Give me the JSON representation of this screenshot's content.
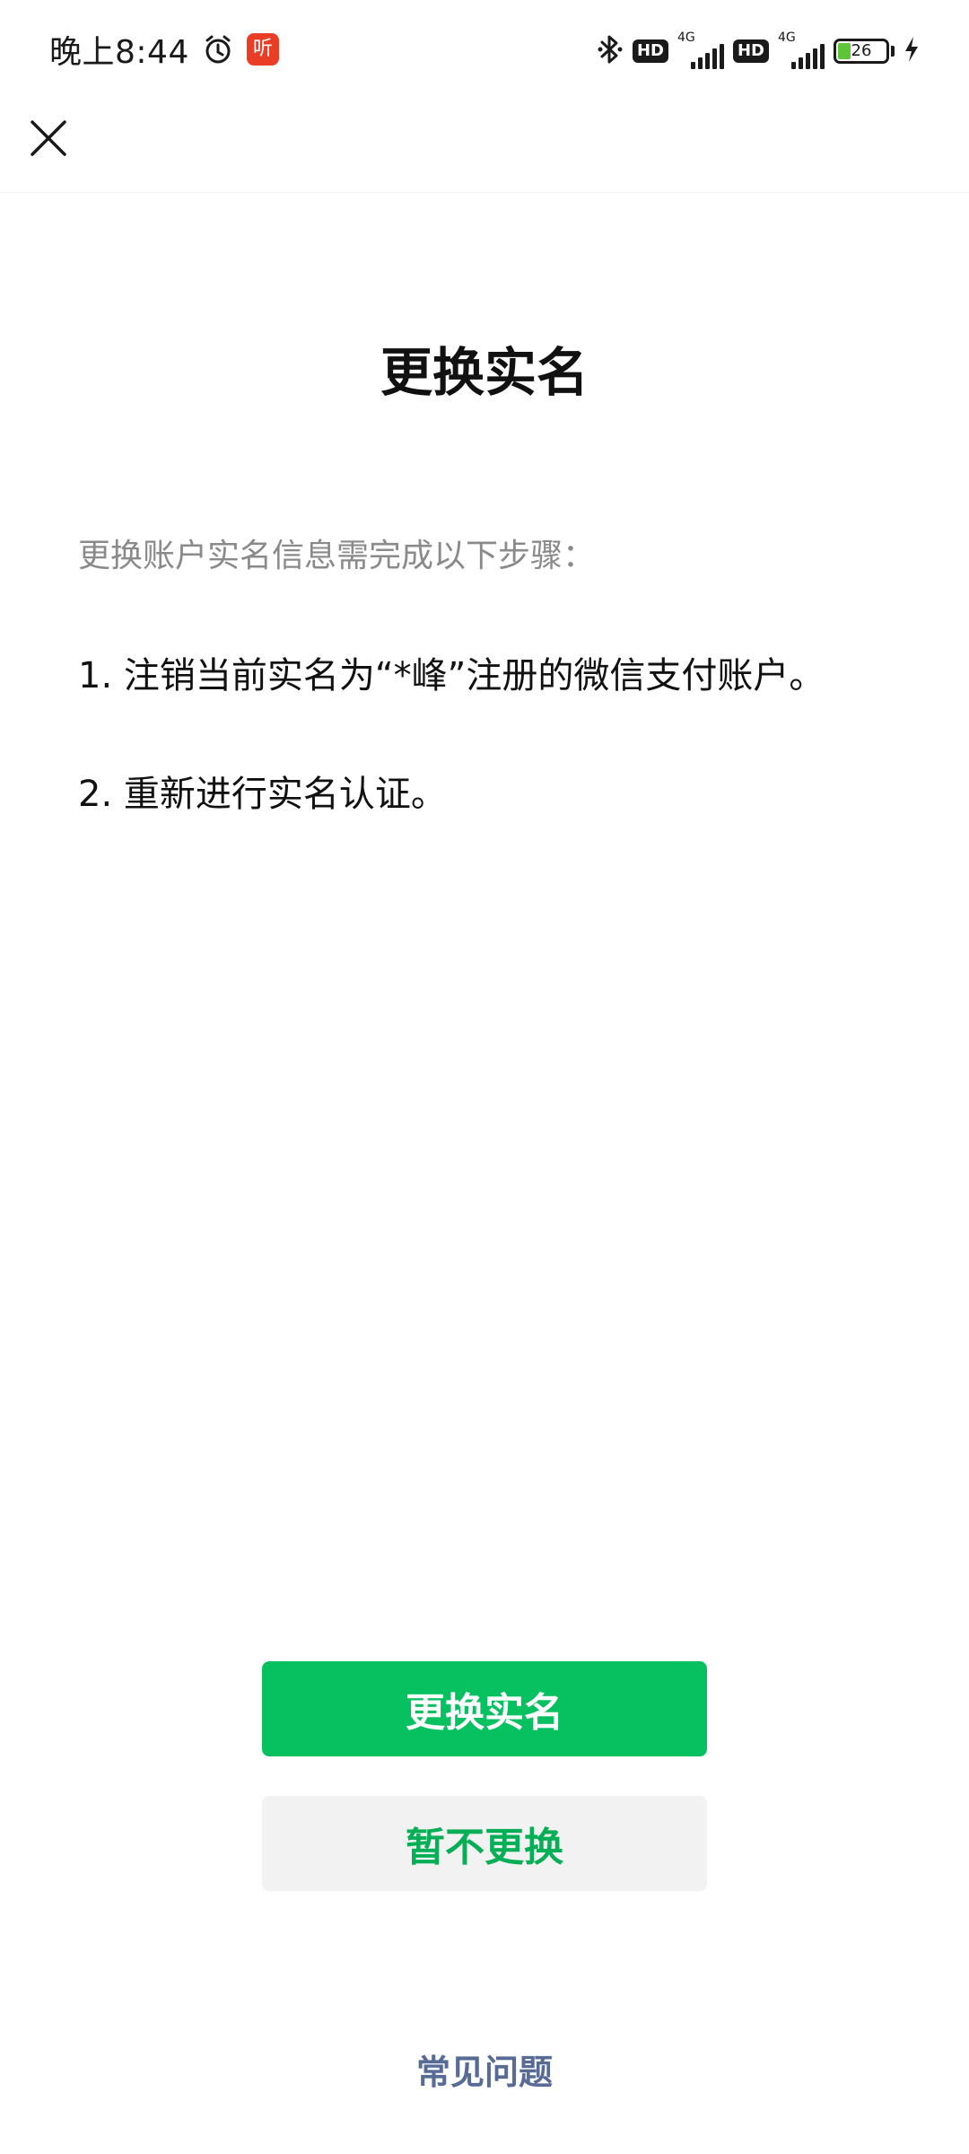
{
  "status_bar": {
    "time": "晚上8:44",
    "listen_badge": "听",
    "network_type_1": "4G",
    "network_type_2": "4G",
    "hd_label": "HD",
    "battery_level": "26",
    "icons": [
      "alarm-icon",
      "bluetooth-icon",
      "charging-icon"
    ]
  },
  "header": {
    "close_icon": "close-icon"
  },
  "main": {
    "title": "更换实名",
    "intro": "更换账户实名信息需完成以下步骤：",
    "steps": [
      "1. 注销当前实名为“*峰”注册的微信支付账户。",
      "2. 重新进行实名认证。"
    ]
  },
  "actions": {
    "primary_label": "更换实名",
    "secondary_label": "暂不更换"
  },
  "footer": {
    "faq_label": "常见问题"
  },
  "colors": {
    "primary": "#07c160",
    "secondary_text": "#06ae56",
    "link": "#576b95",
    "badge": "#ea3d26"
  }
}
